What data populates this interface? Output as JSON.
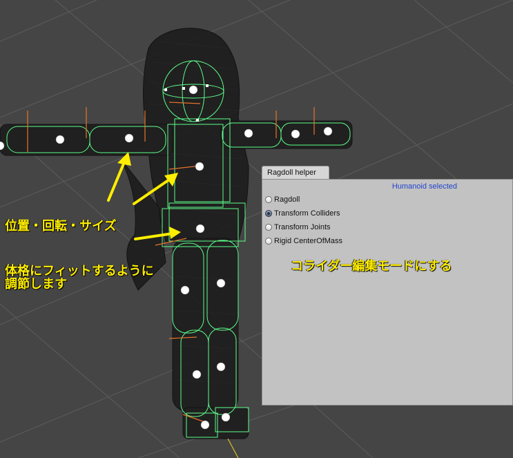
{
  "viewport": {
    "background": "#454545",
    "grid_color": "#5a5a5a",
    "collider_color": "#5dff8a",
    "mesh_color": "#111111"
  },
  "annotations": {
    "pos_rot_size": "位置・回転・サイズ",
    "fit_line1": "体格にフィットするように",
    "fit_line2": "調節します",
    "collider_mode": "コライダー編集モードにする",
    "color": "#ffee00"
  },
  "panel": {
    "tab_title": "Ragdoll helper",
    "status": "Humanoid selected",
    "modes": [
      {
        "label": "Ragdoll",
        "selected": false
      },
      {
        "label": "Transform Colliders",
        "selected": true
      },
      {
        "label": "Transform Joints",
        "selected": false
      },
      {
        "label": "Rigid CenterOfMass",
        "selected": false
      }
    ]
  }
}
